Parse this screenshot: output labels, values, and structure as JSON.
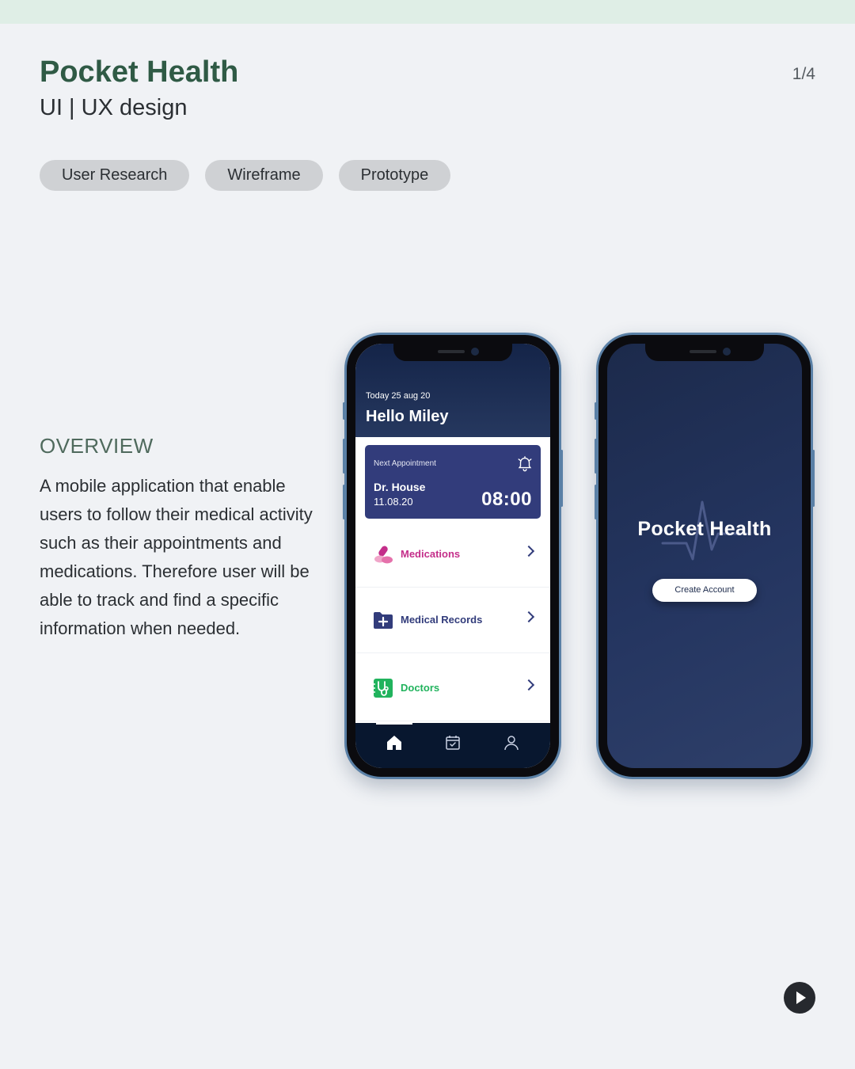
{
  "header": {
    "title": "Pocket Health",
    "subtitle": "UI | UX design",
    "page_indicator": "1/4"
  },
  "tags": [
    "User Research",
    "Wireframe",
    "Prototype"
  ],
  "overview": {
    "heading": "OVERVIEW",
    "text": "A mobile application that enable users to follow their medical activity such as their appointments and medications. Therefore user will be able to track and find a specific information when needed."
  },
  "home_screen": {
    "date": "Today 25 aug 20",
    "greeting": "Hello Miley",
    "appointment": {
      "label": "Next Appointment",
      "doctor": "Dr. House",
      "date": "11.08.20",
      "time": "08:00"
    },
    "menu": [
      {
        "label": "Medications",
        "icon": "pills-icon",
        "color": "#c42e8a"
      },
      {
        "label": "Medical Records",
        "icon": "folder-plus-icon",
        "color": "#323c7b"
      },
      {
        "label": "Doctors",
        "icon": "stethoscope-icon",
        "color": "#21b35d"
      }
    ],
    "nav": [
      "home-icon",
      "calendar-icon",
      "profile-icon"
    ]
  },
  "splash_screen": {
    "title": "Pocket Health",
    "button": "Create Account"
  },
  "colors": {
    "brand_green": "#2f5a45",
    "navy": "#1c2a4b",
    "card": "#323c7b"
  }
}
